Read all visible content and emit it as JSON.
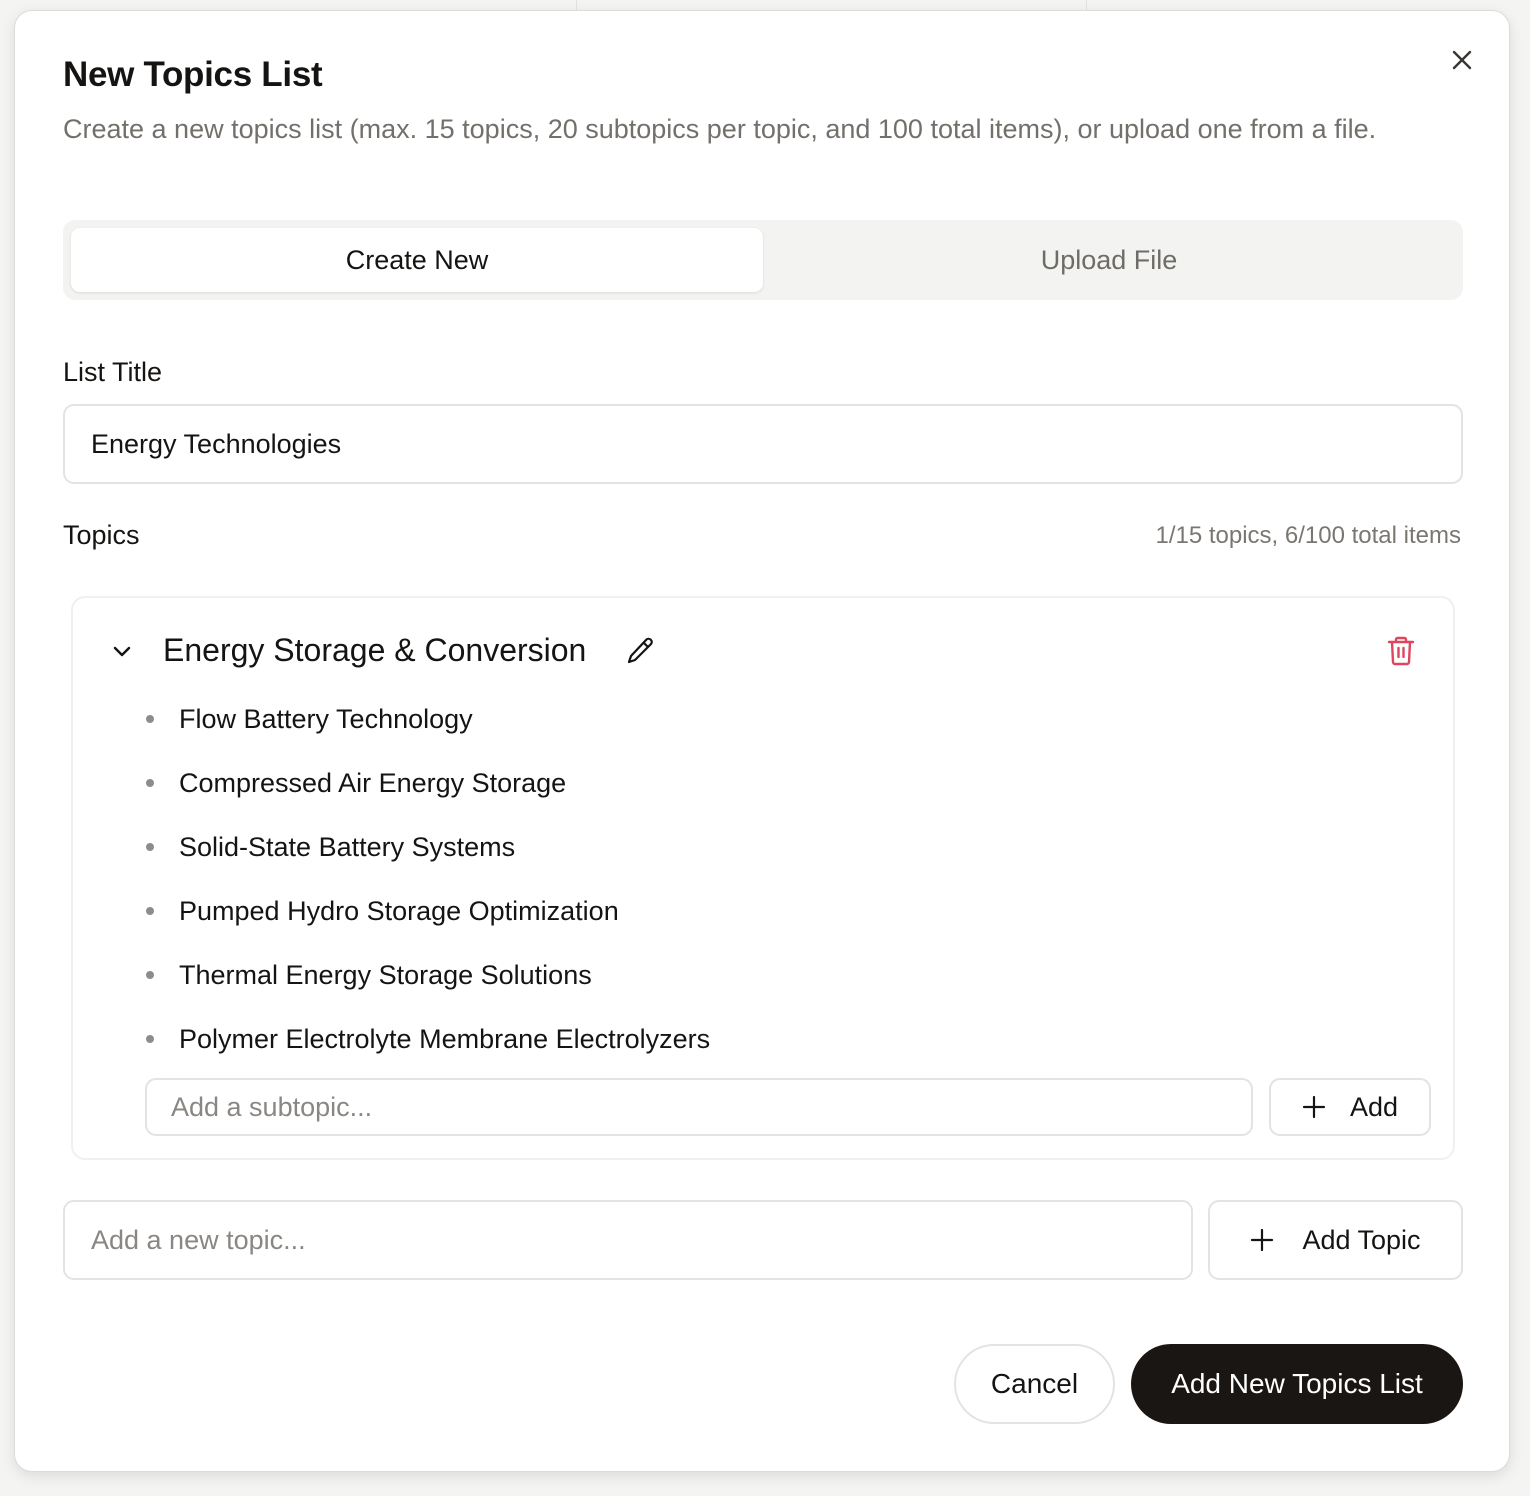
{
  "dialog": {
    "title": "New Topics List",
    "description": "Create a new topics list (max. 15 topics, 20 subtopics per topic, and 100 total items), or upload one from a file."
  },
  "tabs": [
    {
      "label": "Create New",
      "active": true
    },
    {
      "label": "Upload File",
      "active": false
    }
  ],
  "list_title": {
    "label": "List Title",
    "value": "Energy Technologies"
  },
  "topics_section": {
    "label": "Topics",
    "counts": "1/15 topics, 6/100 total items"
  },
  "topics": [
    {
      "name": "Energy Storage & Conversion",
      "expanded": true,
      "subtopics": [
        "Flow Battery Technology",
        "Compressed Air Energy Storage",
        "Solid-State Battery Systems",
        "Pumped Hydro Storage Optimization",
        "Thermal Energy Storage Solutions",
        "Polymer Electrolyte Membrane Electrolyzers"
      ],
      "subtopic_input": {
        "placeholder": "Add a subtopic...",
        "value": ""
      },
      "add_label": "Add"
    }
  ],
  "new_topic": {
    "placeholder": "Add a new topic...",
    "value": "",
    "button_label": "Add Topic"
  },
  "footer": {
    "cancel_label": "Cancel",
    "submit_label": "Add New Topics List"
  },
  "icons": {
    "close": "close-icon",
    "chevron": "chevron-down-icon",
    "edit": "pencil-icon",
    "delete": "trash-icon",
    "plus": "plus-icon"
  },
  "colors": {
    "primary_button": "#1a1614",
    "delete_icon": "#e0455f",
    "muted_text": "#73706b"
  }
}
